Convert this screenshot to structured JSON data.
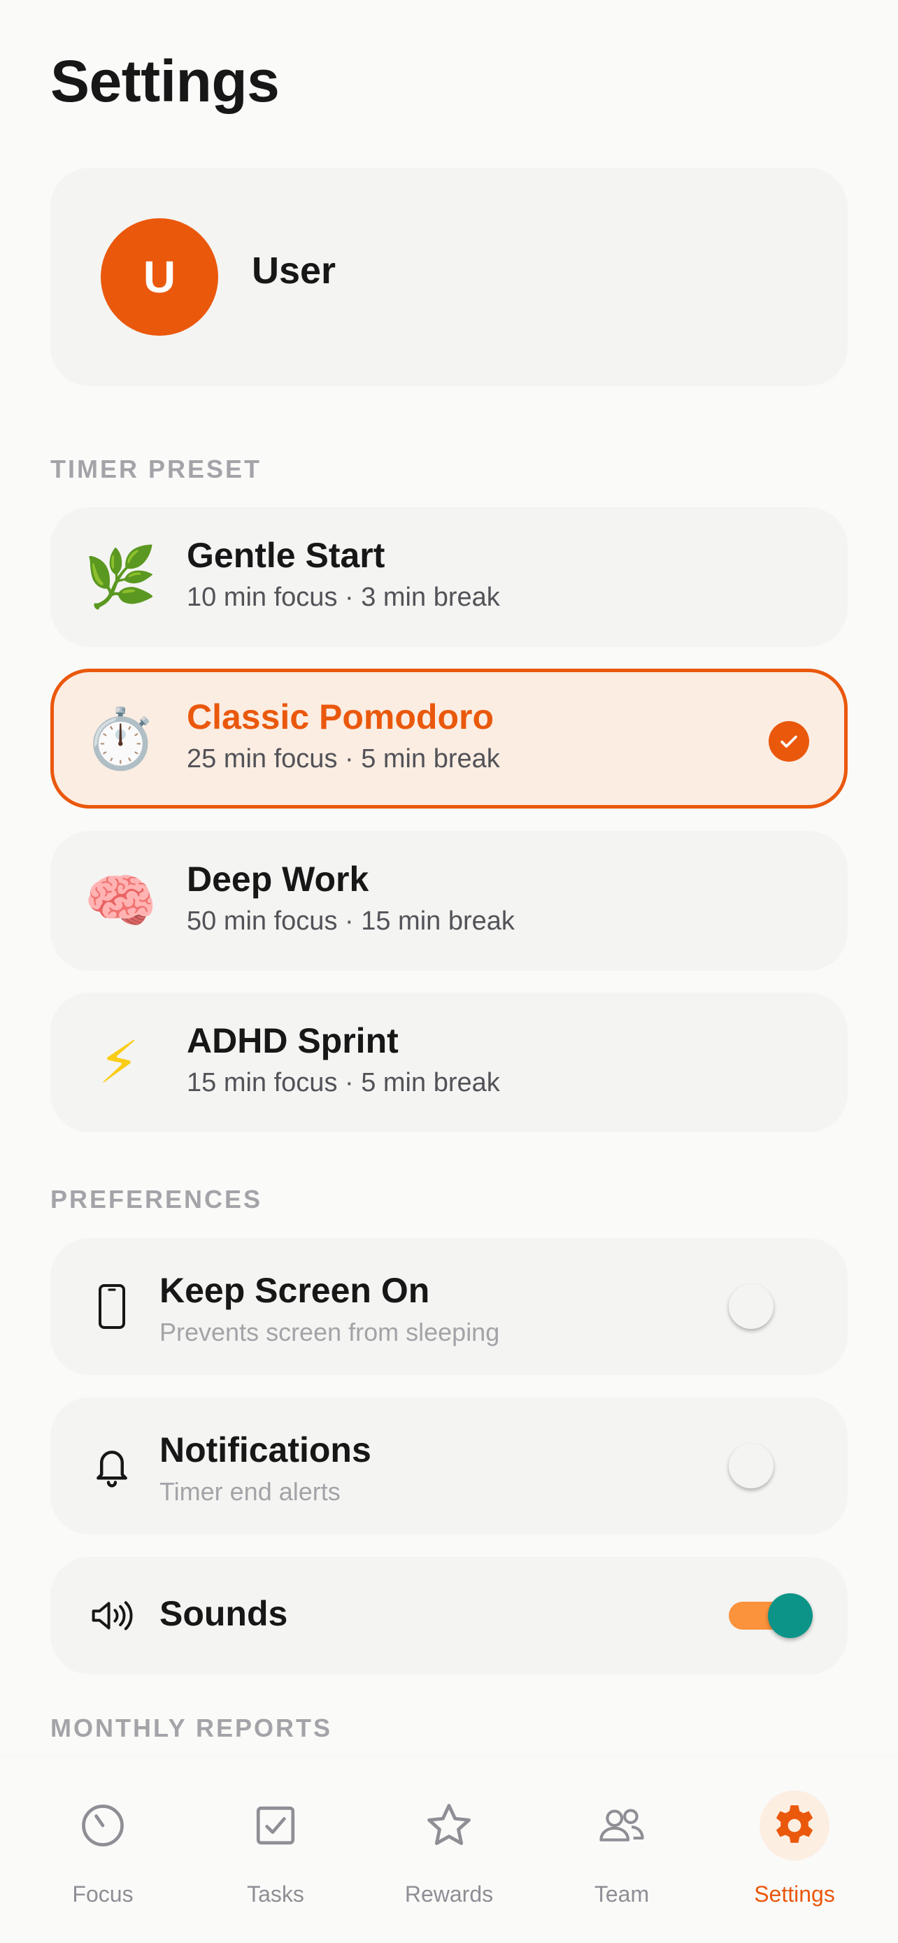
{
  "page": {
    "title": "Settings"
  },
  "profile": {
    "avatar_initial": "U",
    "name": "User"
  },
  "timer_preset": {
    "section_label": "TIMER PRESET",
    "presets": [
      {
        "emoji": "🌿",
        "title": "Gentle Start",
        "subtitle": "10 min focus · 3 min break",
        "selected": false
      },
      {
        "emoji": "⏱️",
        "title": "Classic Pomodoro",
        "subtitle": "25 min focus · 5 min break",
        "selected": true
      },
      {
        "emoji": "🧠",
        "title": "Deep Work",
        "subtitle": "50 min focus · 15 min break",
        "selected": false
      },
      {
        "emoji": "⚡",
        "title": "ADHD Sprint",
        "subtitle": "15 min focus · 5 min break",
        "selected": false
      }
    ]
  },
  "preferences": {
    "section_label": "PREFERENCES",
    "items": [
      {
        "icon": "phone-icon",
        "title": "Keep Screen On",
        "subtitle": "Prevents screen from sleeping",
        "enabled": false
      },
      {
        "icon": "bell-icon",
        "title": "Notifications",
        "subtitle": "Timer end alerts",
        "enabled": false
      },
      {
        "icon": "speaker-icon",
        "title": "Sounds",
        "enabled": true
      }
    ]
  },
  "monthly_reports": {
    "section_label": "MONTHLY REPORTS"
  },
  "nav": {
    "items": [
      {
        "icon": "timer-icon",
        "label": "Focus",
        "active": false
      },
      {
        "icon": "checkbox-icon",
        "label": "Tasks",
        "active": false
      },
      {
        "icon": "star-icon",
        "label": "Rewards",
        "active": false
      },
      {
        "icon": "users-icon",
        "label": "Team",
        "active": false
      },
      {
        "icon": "gear-icon",
        "label": "Settings",
        "active": true
      }
    ]
  },
  "colors": {
    "accent": "#EA580C",
    "accent_soft": "#FBEDE2",
    "toggle_track_on": "#FB923C",
    "toggle_knob_on": "#0D9488",
    "card_bg": "#F4F4F2",
    "muted_text": "#A3A3A8"
  }
}
